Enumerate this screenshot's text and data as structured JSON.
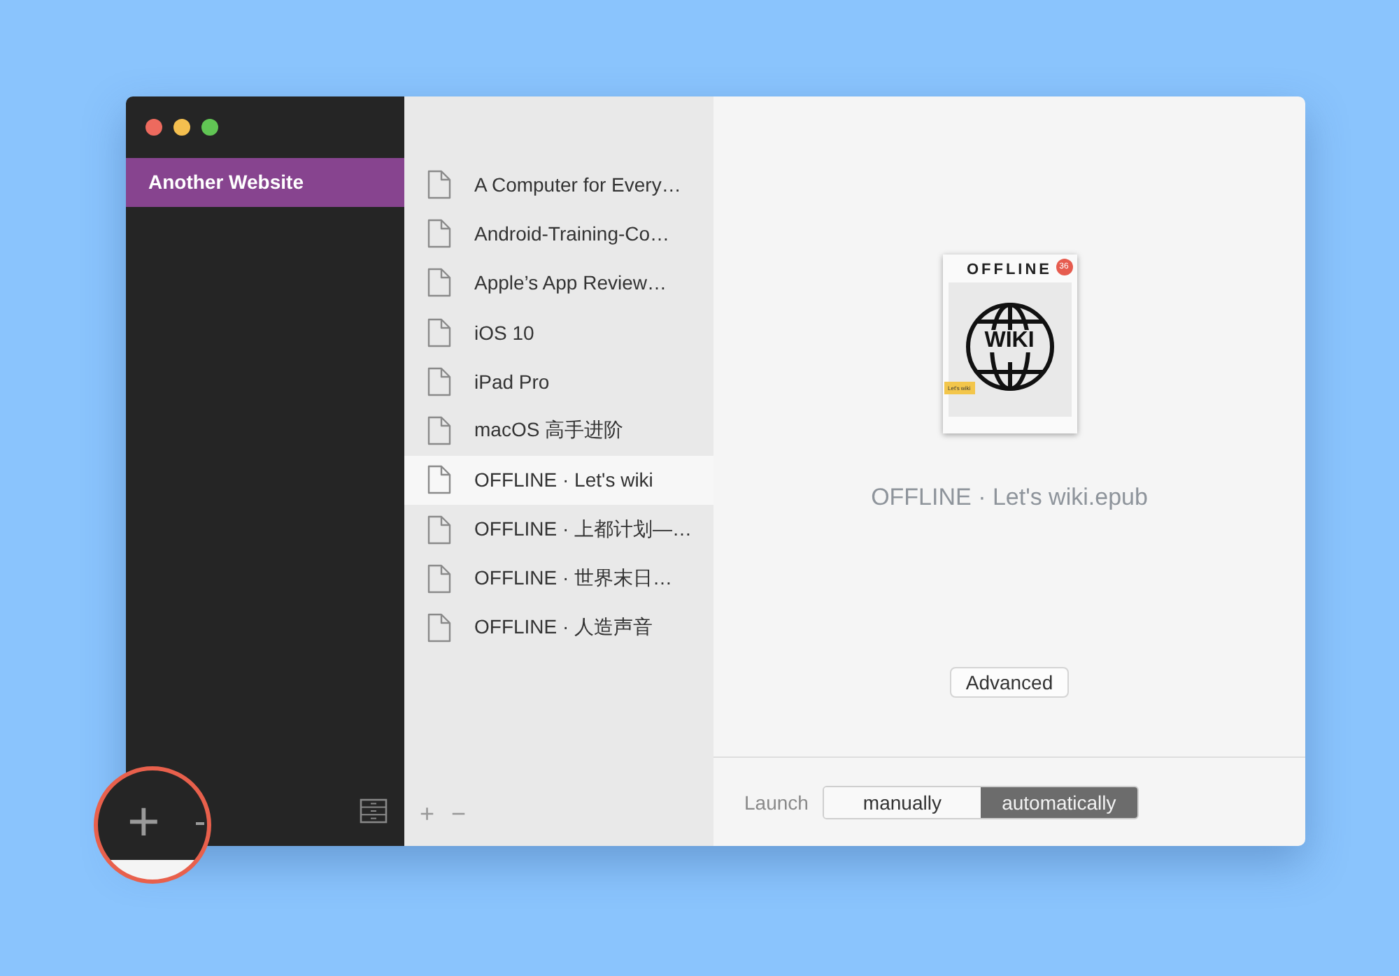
{
  "sidebar": {
    "items": [
      {
        "label": "Another Website",
        "selected": true
      }
    ]
  },
  "documents": [
    {
      "label": "A Computer for Every…",
      "selected": false
    },
    {
      "label": "Android-Training-Co…",
      "selected": false
    },
    {
      "label": "Apple’s App Review…",
      "selected": false
    },
    {
      "label": "iOS 10",
      "selected": false
    },
    {
      "label": "iPad Pro",
      "selected": false
    },
    {
      "label": "macOS 高手进阶",
      "selected": false
    },
    {
      "label": "OFFLINE · Let's wiki",
      "selected": true
    },
    {
      "label": "OFFLINE · 上都计划—…",
      "selected": false
    },
    {
      "label": "OFFLINE · 世界末日…",
      "selected": false
    },
    {
      "label": "OFFLINE · 人造声音",
      "selected": false
    }
  ],
  "list_footer": {
    "buttons": [
      "+",
      "−"
    ]
  },
  "preview": {
    "cover": {
      "title": "OFFLINE",
      "badge": "36",
      "logo_text": "WIKI",
      "tag": "Let's wiki"
    },
    "filename": "OFFLINE · Let's wiki.epub",
    "advanced_button": "Advanced"
  },
  "launch": {
    "label": "Launch",
    "options": [
      {
        "label": "manually",
        "selected": false
      },
      {
        "label": "automatically",
        "selected": true
      }
    ]
  },
  "callout": {
    "button": "+"
  }
}
